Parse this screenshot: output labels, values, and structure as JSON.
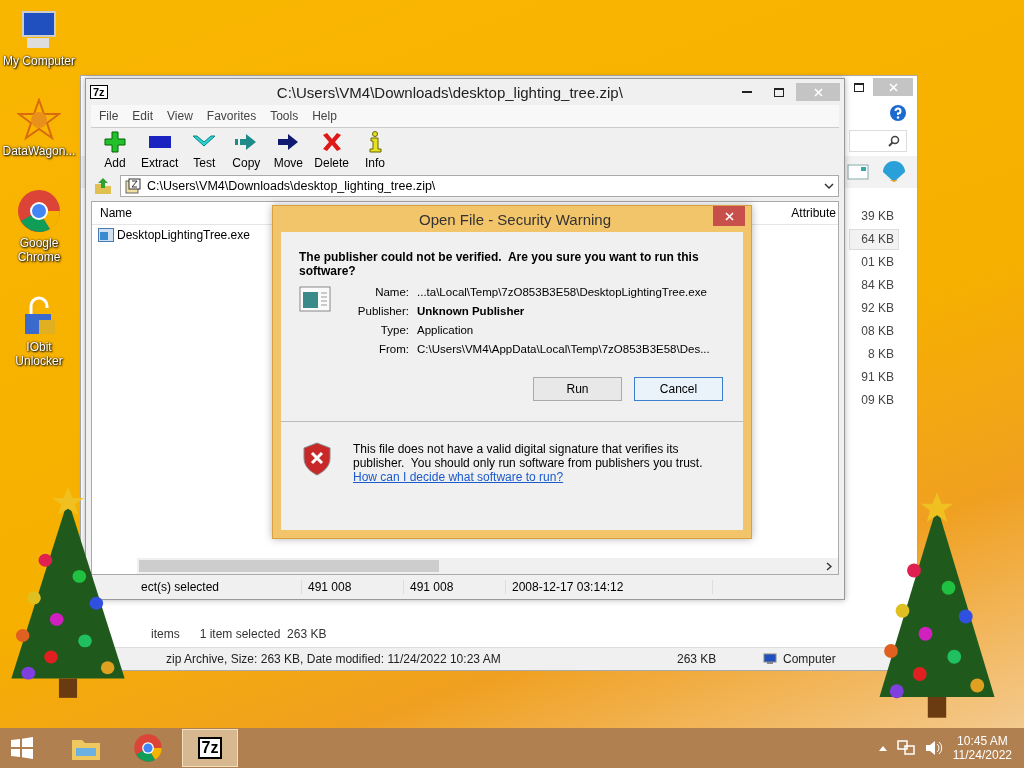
{
  "desktop_icons": [
    {
      "label": "My Computer",
      "kind": "computer"
    },
    {
      "label": "DataWagon...",
      "kind": "star"
    },
    {
      "label": "Google Chrome",
      "kind": "chrome"
    },
    {
      "label": "IObit Unlocker",
      "kind": "lock"
    }
  ],
  "explorer": {
    "sizes": [
      {
        "text": "39 KB",
        "selected": false
      },
      {
        "text": "64 KB",
        "selected": true
      },
      {
        "text": "01 KB",
        "selected": false
      },
      {
        "text": "84 KB",
        "selected": false
      },
      {
        "text": "92 KB",
        "selected": false
      },
      {
        "text": "08 KB",
        "selected": false
      },
      {
        "text": "8 KB",
        "selected": false
      },
      {
        "text": "91 KB",
        "selected": false
      },
      {
        "text": "09 KB",
        "selected": false
      }
    ],
    "status_count": "items",
    "status_selection": "1 item selected  263 KB",
    "details": "zip Archive, Size: 263 KB, Date modified: 11/24/2022 10:23 AM",
    "details_size": "263 KB",
    "details_location": "Computer"
  },
  "sevenzip": {
    "logo": "7z",
    "title": "C:\\Users\\VM4\\Downloads\\desktop_lighting_tree.zip\\",
    "menu": [
      "File",
      "Edit",
      "View",
      "Favorites",
      "Tools",
      "Help"
    ],
    "toolbar": [
      {
        "label": "Add",
        "kind": "add"
      },
      {
        "label": "Extract",
        "kind": "extract"
      },
      {
        "label": "Test",
        "kind": "test"
      },
      {
        "label": "Copy",
        "kind": "copy"
      },
      {
        "label": "Move",
        "kind": "move"
      },
      {
        "label": "Delete",
        "kind": "delete"
      },
      {
        "label": "Info",
        "kind": "info"
      }
    ],
    "address": "C:\\Users\\VM4\\Downloads\\desktop_lighting_tree.zip\\",
    "columns": [
      "Name",
      "Attribute"
    ],
    "rows": [
      {
        "name": "DesktopLightingTree.exe",
        "selected": false
      }
    ],
    "status": [
      "ect(s) selected",
      "491 008",
      "491 008",
      "2008-12-17 03:14:12"
    ]
  },
  "dialog": {
    "title": "Open File - Security Warning",
    "heading": "The publisher could not be verified.  Are you sure you want to run this software?",
    "fields": [
      {
        "label": "Name:",
        "value": "...ta\\Local\\Temp\\7zO853B3E58\\DesktopLightingTree.exe",
        "bold": false
      },
      {
        "label": "Publisher:",
        "value": "Unknown Publisher",
        "bold": true
      },
      {
        "label": "Type:",
        "value": "Application",
        "bold": false
      },
      {
        "label": "From:",
        "value": "C:\\Users\\VM4\\AppData\\Local\\Temp\\7zO853B3E58\\Des...",
        "bold": false
      }
    ],
    "buttons": [
      {
        "label": "Run",
        "focused": false
      },
      {
        "label": "Cancel",
        "focused": true
      }
    ],
    "warning": "This file does not have a valid digital signature that verifies its publisher.  You should only run software from publishers you trust.",
    "link": "How can I decide what software to run?"
  },
  "taskbar": {
    "apps": [
      {
        "kind": "explorer",
        "selected": false
      },
      {
        "kind": "chrome",
        "selected": false
      },
      {
        "kind": "sevenzip",
        "selected": true
      }
    ],
    "logo": "7z",
    "time": "10:45 AM",
    "date": "11/24/2022"
  }
}
